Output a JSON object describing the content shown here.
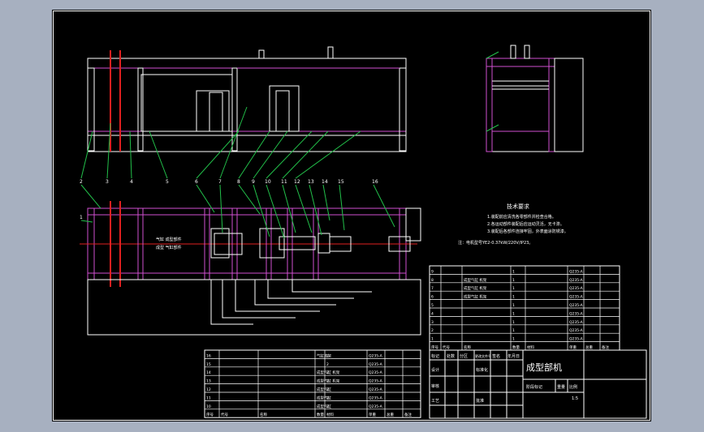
{
  "callouts": [
    "1",
    "2",
    "3",
    "4",
    "5",
    "6",
    "7",
    "8",
    "9",
    "10",
    "11",
    "12",
    "13",
    "14",
    "15",
    "16"
  ],
  "tech_req": {
    "title": "技术要求",
    "lines": [
      "1.装配前应清洗各零部件并检查合格。",
      "2.各运动部件装配后应运动灵活，无卡滞。",
      "3.装配后各部件连接牢固，外表面涂防锈漆。"
    ],
    "motor_note": "注：电机型号YE2-0.37kW/220V/IP23。"
  },
  "plan_labels": [
    "气缸 成型部件",
    "成型 气缸部件"
  ],
  "bom_right": {
    "rows": [
      [
        "9",
        "",
        "1",
        "",
        "Q235-A"
      ],
      [
        "8",
        "成型气缸 机架",
        "1",
        "",
        "Q235-A"
      ],
      [
        "7",
        "成型气缸 机架",
        "1",
        "",
        "Q235-A"
      ],
      [
        "6",
        "成型气缸 机架",
        "1",
        "",
        "Q235-A"
      ],
      [
        "5",
        "",
        "1",
        "",
        "Q235-A"
      ],
      [
        "4",
        "",
        "1",
        "",
        "Q235-A"
      ],
      [
        "3",
        "",
        "1",
        "",
        "Q235-A"
      ],
      [
        "2",
        "",
        "1",
        "",
        "Q235-A"
      ],
      [
        "1",
        "",
        "1",
        "",
        "Q235-A"
      ]
    ],
    "header": [
      "序号",
      "代号",
      "名称",
      "数量",
      "材料",
      "单重",
      "总重",
      "备注"
    ]
  },
  "bom_left": {
    "rows": [
      [
        "16",
        "",
        "气缸支架",
        "2",
        "Q235-A"
      ],
      [
        "15",
        "",
        "",
        "2",
        "Q235-A"
      ],
      [
        "14",
        "",
        "成型气缸 机架",
        "2",
        "Q235-A"
      ],
      [
        "13",
        "",
        "成型气缸 机架",
        "2",
        "Q235-A"
      ],
      [
        "12",
        "",
        "成型气缸",
        "2",
        "Q235-A"
      ],
      [
        "11",
        "",
        "成型气缸",
        "2",
        "Q235-A"
      ],
      [
        "10",
        "",
        "成型气缸",
        "2",
        "Q235-A"
      ]
    ],
    "header": [
      "序号",
      "代号",
      "名称",
      "数量",
      "材料",
      "单重",
      "总重",
      "备注"
    ]
  },
  "title_block": {
    "drawing_title": "成型部机",
    "row1": [
      "标记",
      "处数",
      "分区",
      "更改文件号",
      "签名",
      "年月日"
    ],
    "row2": [
      "设计",
      "",
      "标准化"
    ],
    "row3": [
      "审核"
    ],
    "row4": [
      "工艺",
      "",
      "批准"
    ],
    "stage": "阶段标记",
    "weight": "重量",
    "scale": "比例",
    "scale_value": "1:5"
  }
}
